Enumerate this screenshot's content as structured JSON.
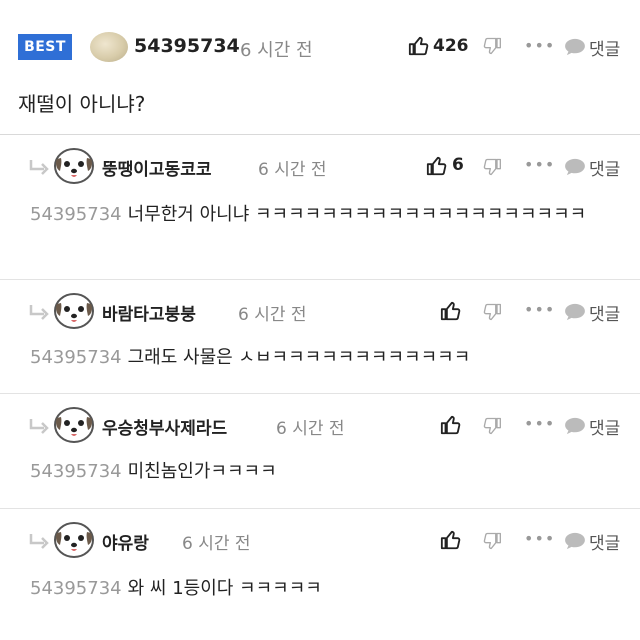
{
  "best_comment": {
    "badge": "BEST",
    "username": "54395734",
    "time": "6 시간 전",
    "likes": "426",
    "more": "•••",
    "reply_label": "댓글",
    "text": "재떨이 아니냐?"
  },
  "replies": [
    {
      "username": "뚱땡이고동코코",
      "time": "6 시간 전",
      "likes": "6",
      "more": "•••",
      "reply_label": "댓글",
      "mention": "54395734",
      "text": "너무한거 아니냐 ㅋㅋㅋㅋㅋㅋㅋㅋㅋㅋㅋㅋㅋㅋㅋㅋㅋㅋㅋㅋ"
    },
    {
      "username": "바람타고붕붕",
      "time": "6 시간 전",
      "more": "•••",
      "reply_label": "댓글",
      "mention": "54395734",
      "text": "그래도 사물은 ㅅㅂㅋㅋㅋㅋㅋㅋㅋㅋㅋㅋㅋㅋ"
    },
    {
      "username": "우승청부사제라드",
      "time": "6 시간 전",
      "more": "•••",
      "reply_label": "댓글",
      "mention": "54395734",
      "text": "미친놈인가ㅋㅋㅋㅋ"
    },
    {
      "username": "야유랑",
      "time": "6 시간 전",
      "more": "•••",
      "reply_label": "댓글",
      "mention": "54395734",
      "text": "와 씨 1등이다 ㅋㅋㅋㅋㅋ"
    }
  ],
  "colors": {
    "badge": "#2f6fd6",
    "muted_text": "#888888",
    "divider": "#d9d9d9"
  },
  "icons": [
    "thumbs-up-icon",
    "thumbs-down-icon",
    "more-icon",
    "speech-bubble-icon",
    "reply-arrow-icon",
    "puppy-avatar-icon"
  ]
}
